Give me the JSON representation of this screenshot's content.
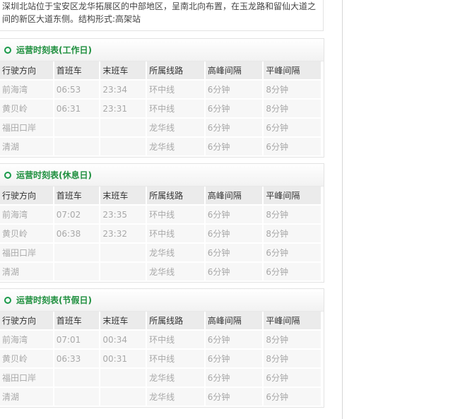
{
  "intro": {
    "line1": "深圳北站位于宝安区龙华拓展区的中部地区，呈南北向布置，在玉龙路和留仙大道之",
    "line2": "间的新区大道东侧。结构形式:高架站"
  },
  "columns": [
    "行驶方向",
    "首班车",
    "末班车",
    "所属线路",
    "高峰间隔",
    "平峰间隔"
  ],
  "timetables": [
    {
      "title": "运营时刻表(工作日)",
      "rows": [
        [
          "前海湾",
          "06:53",
          "23:34",
          "环中线",
          "6分钟",
          "8分钟"
        ],
        [
          "黄贝岭",
          "06:31",
          "23:31",
          "环中线",
          "6分钟",
          "8分钟"
        ],
        [
          "福田口岸",
          "",
          "",
          "龙华线",
          "6分钟",
          "6分钟"
        ],
        [
          "清湖",
          "",
          "",
          "龙华线",
          "6分钟",
          "6分钟"
        ]
      ]
    },
    {
      "title": "运营时刻表(休息日)",
      "rows": [
        [
          "前海湾",
          "07:02",
          "23:35",
          "环中线",
          "6分钟",
          "8分钟"
        ],
        [
          "黄贝岭",
          "06:38",
          "23:32",
          "环中线",
          "6分钟",
          "8分钟"
        ],
        [
          "福田口岸",
          "",
          "",
          "龙华线",
          "6分钟",
          "6分钟"
        ],
        [
          "清湖",
          "",
          "",
          "龙华线",
          "6分钟",
          "6分钟"
        ]
      ]
    },
    {
      "title": "运营时刻表(节假日)",
      "rows": [
        [
          "前海湾",
          "07:01",
          "00:34",
          "环中线",
          "6分钟",
          "8分钟"
        ],
        [
          "黄贝岭",
          "06:33",
          "00:31",
          "环中线",
          "6分钟",
          "8分钟"
        ],
        [
          "福田口岸",
          "",
          "",
          "龙华线",
          "6分钟",
          "6分钟"
        ],
        [
          "清湖",
          "",
          "",
          "龙华线",
          "6分钟",
          "6分钟"
        ]
      ]
    }
  ],
  "colors": {
    "accent": "#1e8f3e",
    "header_bg": "#ebebeb",
    "cell_bg": "#f7f7f7",
    "cell_text": "#a8a8a8"
  }
}
